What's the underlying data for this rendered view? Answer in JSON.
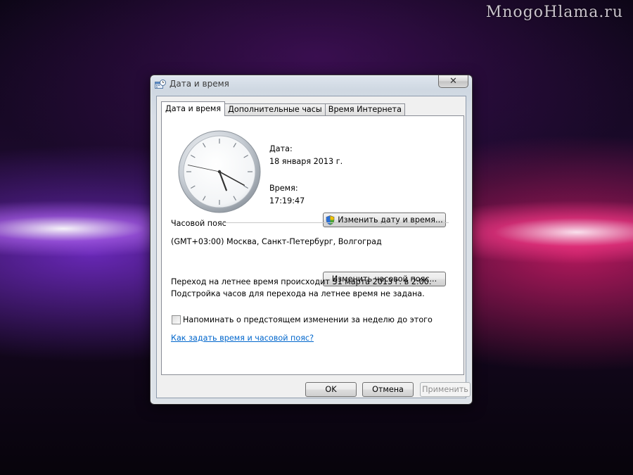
{
  "watermark": "MnogoHlama.ru",
  "window": {
    "title": "Дата и время",
    "close_glyph": "✕",
    "icon": "date-time-icon",
    "tabs": [
      {
        "label": "Дата и время",
        "active": true
      },
      {
        "label": "Дополнительные часы",
        "active": false
      },
      {
        "label": "Время Интернета",
        "active": false
      }
    ],
    "date_label": "Дата:",
    "date_value": "18 января 2013 г.",
    "time_label": "Время:",
    "time_value": "17:19:47",
    "change_datetime_button": "Изменить дату и время...",
    "timezone_section_label": "Часовой пояс",
    "timezone_value": "(GMT+03:00) Москва, Санкт-Петербург, Волгоград",
    "change_timezone_button": "Изменить часовой пояс...",
    "dst_line1": "Переход на летнее время происходит 31 марта 2013 г. в 2:00.",
    "dst_line2": "Подстройка часов для перехода на летнее время не задана.",
    "reminder_checkbox_label": "Напоминать о предстоящем изменении за неделю до этого",
    "reminder_checked": false,
    "help_link": "Как задать время и часовой пояс?",
    "ok_button": "OK",
    "cancel_button": "Отмена",
    "apply_button": "Применить",
    "apply_enabled": false
  },
  "colors": {
    "link": "#0066cc",
    "panel_background": "#ffffff",
    "dialog_background": "#f0f0f0"
  }
}
